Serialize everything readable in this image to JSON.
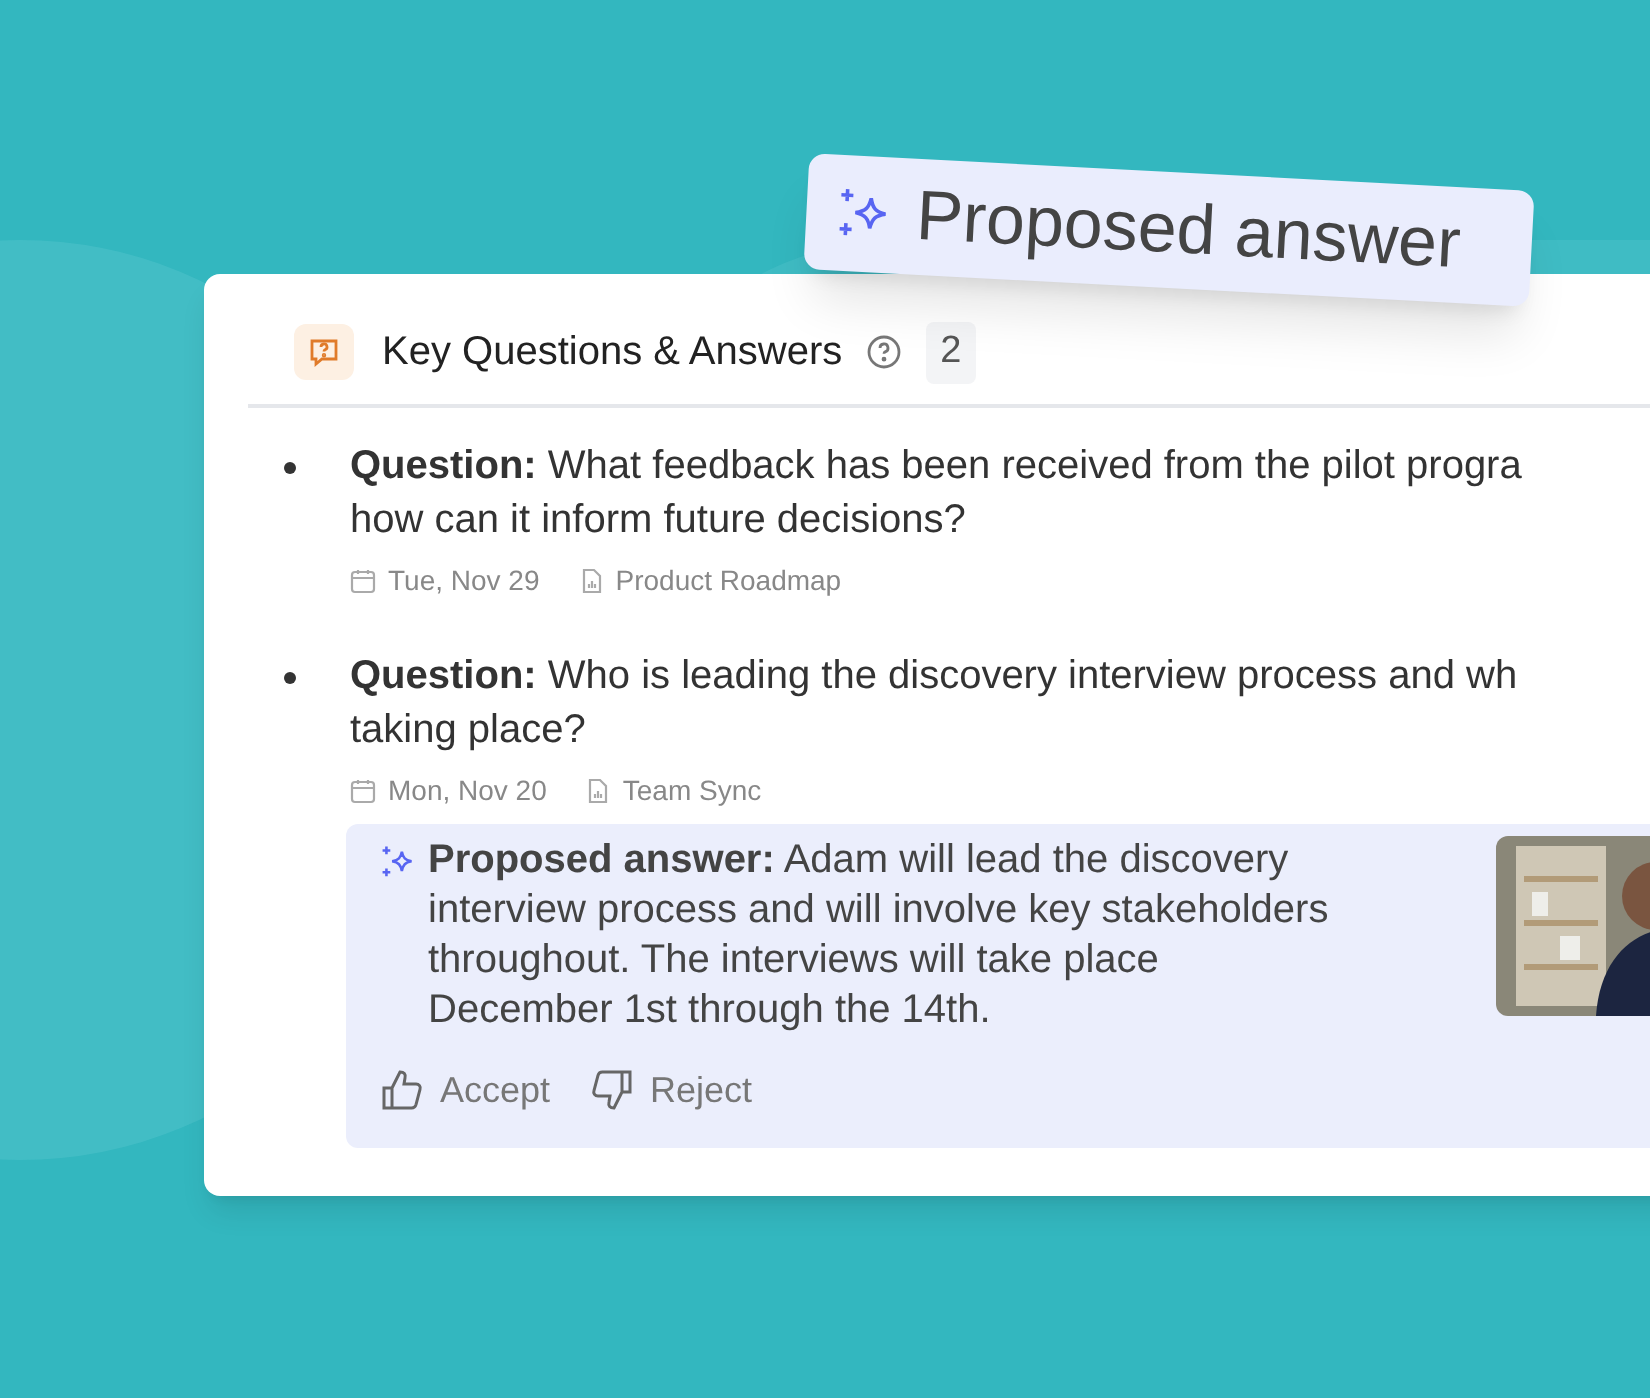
{
  "badge": {
    "label": "Proposed answer"
  },
  "section": {
    "title": "Key Questions & Answers",
    "count": "2"
  },
  "questions": [
    {
      "lines": [
        "**Question:** What feedback has been received from the pilot progra",
        "how can it inform future decisions?"
      ],
      "date": "Tue, Nov 29",
      "source": "Product Roadmap"
    },
    {
      "lines": [
        "**Question:** Who is leading the discovery interview process and wh",
        "taking place?"
      ],
      "date": "Mon, Nov 20",
      "source": "Team Sync",
      "answer": {
        "lines": [
          "**Proposed answer:** Adam will lead the discovery",
          "interview process and will involve key stakeholders",
          "throughout. The interviews will take place",
          "December 1st through the 14th."
        ],
        "actions": [
          "Accept",
          "Reject"
        ]
      }
    }
  ]
}
